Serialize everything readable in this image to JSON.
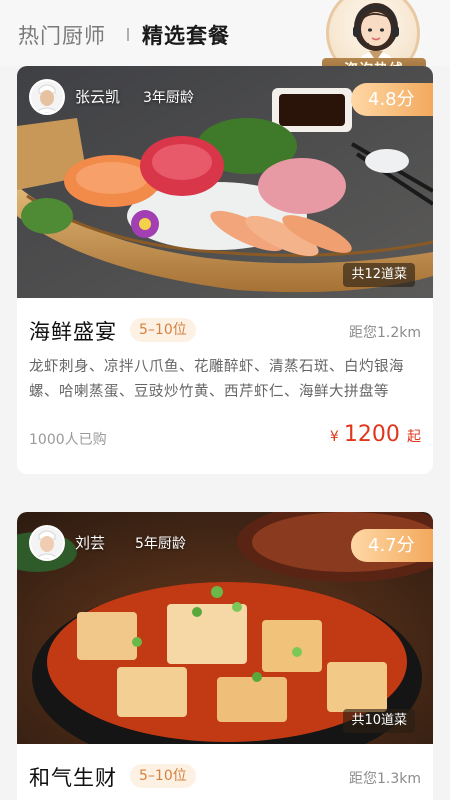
{
  "header": {
    "tab_hot_chef": "热门厨师",
    "tab_selected_packages": "精选套餐",
    "hotline_label": "咨询热线"
  },
  "packages": [
    {
      "chef_name": "张云凯",
      "chef_experience": "3年厨龄",
      "rating": "4.8分",
      "dish_count": "共12道菜",
      "title": "海鲜盛宴",
      "people": "5–10位",
      "distance": "距您1.2km",
      "dishes": "龙虾刺身、凉拌八爪鱼、花雕醉虾、清蒸石斑、白灼银海螺、哈喇蒸蛋、豆豉炒竹黄、西芹虾仁、海鲜大拼盘等",
      "purchased": "1000人已购",
      "price_symbol": "¥",
      "price": "1200",
      "price_suffix": "起"
    },
    {
      "chef_name": "刘芸",
      "chef_experience": "5年厨龄",
      "rating": "4.7分",
      "dish_count": "共10道菜",
      "title": "和气生财",
      "people": "5–10位",
      "distance": "距您1.3km"
    }
  ],
  "colors": {
    "accent": "#e0361c",
    "rating_gradient_start": "#ffd8a6",
    "rating_gradient_end": "#f2a95c",
    "people_tag_text": "#d4813f",
    "people_tag_bg": "#fdf1e4"
  },
  "icons": [
    "chef-avatar",
    "customer-service-avatar"
  ]
}
